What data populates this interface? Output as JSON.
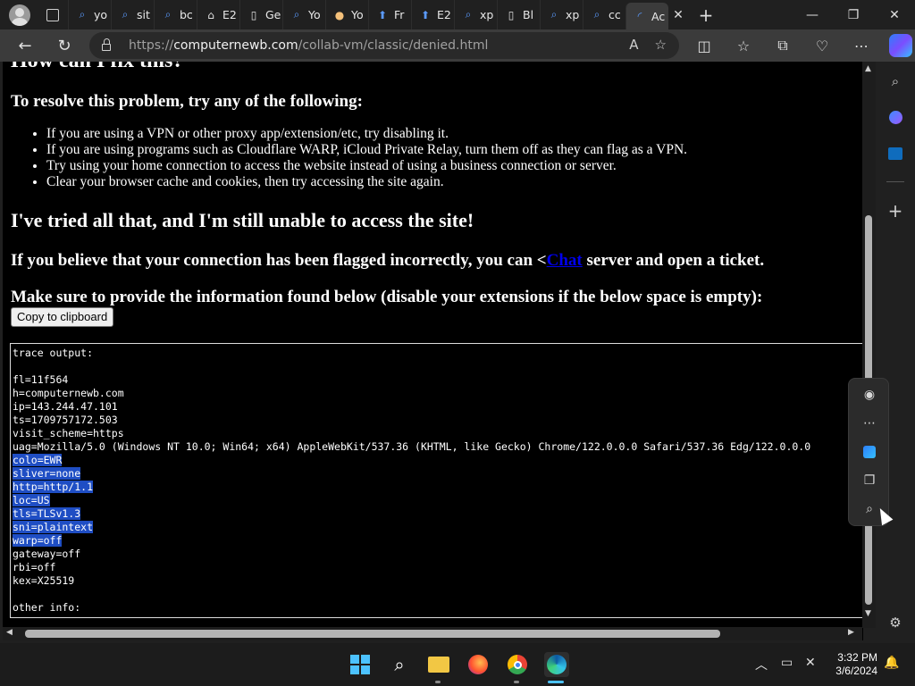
{
  "browser": {
    "tabs": [
      {
        "icon": "search-icon",
        "title": "yo"
      },
      {
        "icon": "search-icon",
        "title": "sit"
      },
      {
        "icon": "search-icon",
        "title": "bc"
      },
      {
        "icon": "bank-icon",
        "title": "E2"
      },
      {
        "icon": "page-icon",
        "title": "Ge"
      },
      {
        "icon": "search-icon",
        "title": "Yo"
      },
      {
        "icon": "egg-icon",
        "title": "Yo"
      },
      {
        "icon": "arrow-up-icon",
        "title": "Fr"
      },
      {
        "icon": "arrow-up-icon",
        "title": "E2"
      },
      {
        "icon": "search-icon",
        "title": "xp"
      },
      {
        "icon": "page-icon",
        "title": "Bl"
      },
      {
        "icon": "search-icon",
        "title": "xp"
      },
      {
        "icon": "search-icon",
        "title": "cc"
      }
    ],
    "active_tab": {
      "icon": "loading-icon",
      "title": "Ac"
    },
    "url_prefix": "https://",
    "url_host": "computernewb.com",
    "url_path": "/collab-vm/classic/denied.html"
  },
  "page": {
    "partial_heading": "How can I fix this?",
    "resolve_heading": "To resolve this problem, try any of the following:",
    "fixes": [
      "If you are using a VPN or other proxy app/extension/etc, try disabling it.",
      "If you are using programs such as Cloudflare WARP, iCloud Private Relay, turn them off as they can flag as a VPN.",
      "Try using your home connection to access the website instead of using a business connection or server.",
      "Clear your browser cache and cookies, then try accessing the site again."
    ],
    "tried_heading": "I've tried all that, and I'm still unable to access the site!",
    "flagged_before": "If you believe that your connection has been flagged incorrectly, you can <",
    "flagged_link": "Chat",
    "flagged_after": " server and open a ticket.",
    "provide_info": "Make sure to provide the information found below (disable your extensions if the below space is empty):",
    "copy_button": "Copy to clipboard",
    "trace_lines": [
      {
        "text": "trace output:",
        "selected": false
      },
      {
        "text": "",
        "selected": false
      },
      {
        "text": "fl=11f564",
        "selected": false
      },
      {
        "text": "h=computernewb.com",
        "selected": false
      },
      {
        "text": "ip=143.244.47.101",
        "selected": false
      },
      {
        "text": "ts=1709757172.503",
        "selected": false
      },
      {
        "text": "visit_scheme=https",
        "selected": false
      },
      {
        "text": "uag=Mozilla/5.0 (Windows NT 10.0; Win64; x64) AppleWebKit/537.36 (KHTML, like Gecko) Chrome/122.0.0.0 Safari/537.36 Edg/122.0.0.0",
        "selected": false
      },
      {
        "text": "colo=EWR",
        "selected": true
      },
      {
        "text": "sliver=none",
        "selected": true
      },
      {
        "text": "http=http/1.1",
        "selected": true
      },
      {
        "text": "loc=US",
        "selected": true
      },
      {
        "text": "tls=TLSv1.3",
        "selected": true
      },
      {
        "text": "sni=plaintext",
        "selected": true
      },
      {
        "text": "warp=off",
        "selected": true
      },
      {
        "text": "gateway=off",
        "selected": false
      },
      {
        "text": "rbi=off",
        "selected": false
      },
      {
        "text": "kex=X25519",
        "selected": false
      },
      {
        "text": "",
        "selected": false
      },
      {
        "text": "other info:",
        "selected": false
      }
    ]
  },
  "taskbar": {
    "time": "3:32 PM",
    "date": "3/6/2024"
  },
  "colors": {
    "selection": "#1f4ec4",
    "link": "#0000ee",
    "page_bg": "#000000",
    "chrome_bg": "#202020"
  }
}
